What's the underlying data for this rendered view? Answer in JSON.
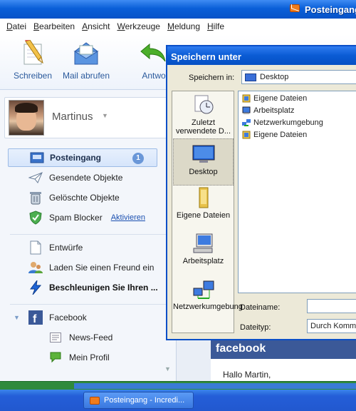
{
  "window": {
    "title": "Posteingang"
  },
  "menu": [
    {
      "first": "D",
      "rest": "atei"
    },
    {
      "first": "B",
      "rest": "earbeiten"
    },
    {
      "first": "A",
      "rest": "nsicht"
    },
    {
      "first": "W",
      "rest": "erkzeuge"
    },
    {
      "first": "M",
      "rest": "eldung"
    },
    {
      "first": "H",
      "rest": "ilfe"
    }
  ],
  "toolbar": {
    "write": "Schreiben",
    "fetch": "Mail abrufen",
    "reply": "Antwo"
  },
  "profile": {
    "name": "Martinus"
  },
  "folders": {
    "inbox": "Posteingang",
    "inbox_count": "1",
    "sent": "Gesendete Objekte",
    "deleted": "Gelöschte Objekte",
    "spam": "Spam Blocker",
    "spam_action": "Aktivieren",
    "drafts": "Entwürfe",
    "invite": "Laden Sie einen Freund ein",
    "speedup": "Beschleunigen Sie Ihren ..."
  },
  "facebook": {
    "label": "Facebook",
    "feed": "News-Feed",
    "profile": "Mein Profil"
  },
  "mail": {
    "banner": "facebook",
    "greeting": "Hallo Martin,"
  },
  "dialog": {
    "title": "Speichern unter",
    "save_in_label": "Speichern in:",
    "save_in_value": "Desktop",
    "places": {
      "recent": "Zuletzt verwendete D...",
      "desktop": "Desktop",
      "documents": "Eigene Dateien",
      "computer": "Arbeitsplatz",
      "network": "Netzwerkumgebung"
    },
    "files": [
      "Eigene Dateien",
      "Arbeitsplatz",
      "Netzwerkumgebung",
      "Eigene Dateien"
    ],
    "filename_label": "Dateiname:",
    "filename_value": "",
    "filetype_label": "Dateityp:",
    "filetype_value": "Durch Komma"
  },
  "taskbar": {
    "task": "Posteingang - Incredi..."
  }
}
